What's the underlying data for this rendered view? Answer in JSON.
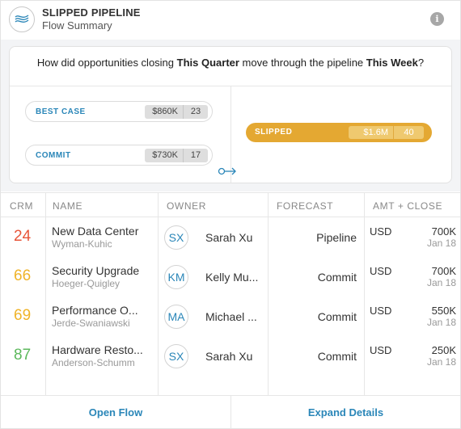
{
  "header": {
    "title": "SLIPPED PIPELINE",
    "subtitle": "Flow Summary",
    "info_glyph": "i"
  },
  "question": {
    "pre": "How did opportunities closing ",
    "bold1": "This Quarter",
    "mid": " move through the pipeline ",
    "bold2": "This Week",
    "post": "?"
  },
  "sources": [
    {
      "label": "BEST CASE",
      "amount": "$860K",
      "count": "23"
    },
    {
      "label": "COMMIT",
      "amount": "$730K",
      "count": "17"
    }
  ],
  "target": {
    "label": "SLIPPED",
    "amount": "$1.6M",
    "count": "40",
    "color": "#e4a832"
  },
  "table": {
    "headers": {
      "crm": "CRM",
      "name": "NAME",
      "owner": "OWNER",
      "forecast": "FORECAST",
      "amt_close": "AMT + CLOSE"
    },
    "rows": [
      {
        "crm": "24",
        "crm_color": "#e8553a",
        "name": "New Data Center",
        "account": "Wyman-Kuhic",
        "initials": "SX",
        "owner": "Sarah Xu",
        "forecast": "Pipeline",
        "currency": "USD",
        "amount": "700K",
        "close": "Jan 18"
      },
      {
        "crm": "66",
        "crm_color": "#f0b429",
        "name": "Security Upgrade",
        "account": "Hoeger-Quigley",
        "initials": "KM",
        "owner": "Kelly Mu...",
        "forecast": "Commit",
        "currency": "USD",
        "amount": "700K",
        "close": "Jan 18"
      },
      {
        "crm": "69",
        "crm_color": "#f0b429",
        "name": "Performance O...",
        "account": "Jerde-Swaniawski",
        "initials": "MA",
        "owner": "Michael ...",
        "forecast": "Commit",
        "currency": "USD",
        "amount": "550K",
        "close": "Jan 18"
      },
      {
        "crm": "87",
        "crm_color": "#5cb85c",
        "name": "Hardware Resto...",
        "account": "Anderson-Schumm",
        "initials": "SX",
        "owner": "Sarah Xu",
        "forecast": "Commit",
        "currency": "USD",
        "amount": "250K",
        "close": "Jan 18"
      }
    ]
  },
  "footer": {
    "open_flow": "Open Flow",
    "expand_details": "Expand Details"
  },
  "colors": {
    "accent": "#2a86b8"
  }
}
